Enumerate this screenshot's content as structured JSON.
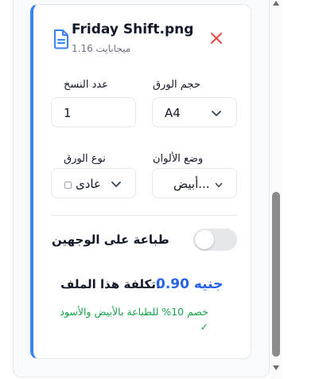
{
  "file": {
    "name": "Friday Shift.png",
    "size": "1.16 ميجابايت",
    "icon": "document-icon",
    "remove_icon": "close-icon"
  },
  "options": {
    "copies": {
      "label": "عدد النسخ",
      "value": "1"
    },
    "paper_size": {
      "label": "حجم الورق",
      "value": "A4"
    },
    "paper_type": {
      "label": "نوع الورق",
      "value": "عادى"
    },
    "color_mode": {
      "label": "وضع الألوان",
      "value": "أبيض..."
    }
  },
  "duplex": {
    "label": "طباعة على الوجهين",
    "enabled": false
  },
  "cost": {
    "label": "تكلفة هذا الملف:",
    "value": "0.90 جنيه"
  },
  "discount_note": "خصم 10% للطباعة بالأبيض والأسود ✓",
  "colors": {
    "accent": "#3b82f6",
    "price": "#2563eb",
    "discount": "#16a34a",
    "remove": "#ef4444"
  }
}
